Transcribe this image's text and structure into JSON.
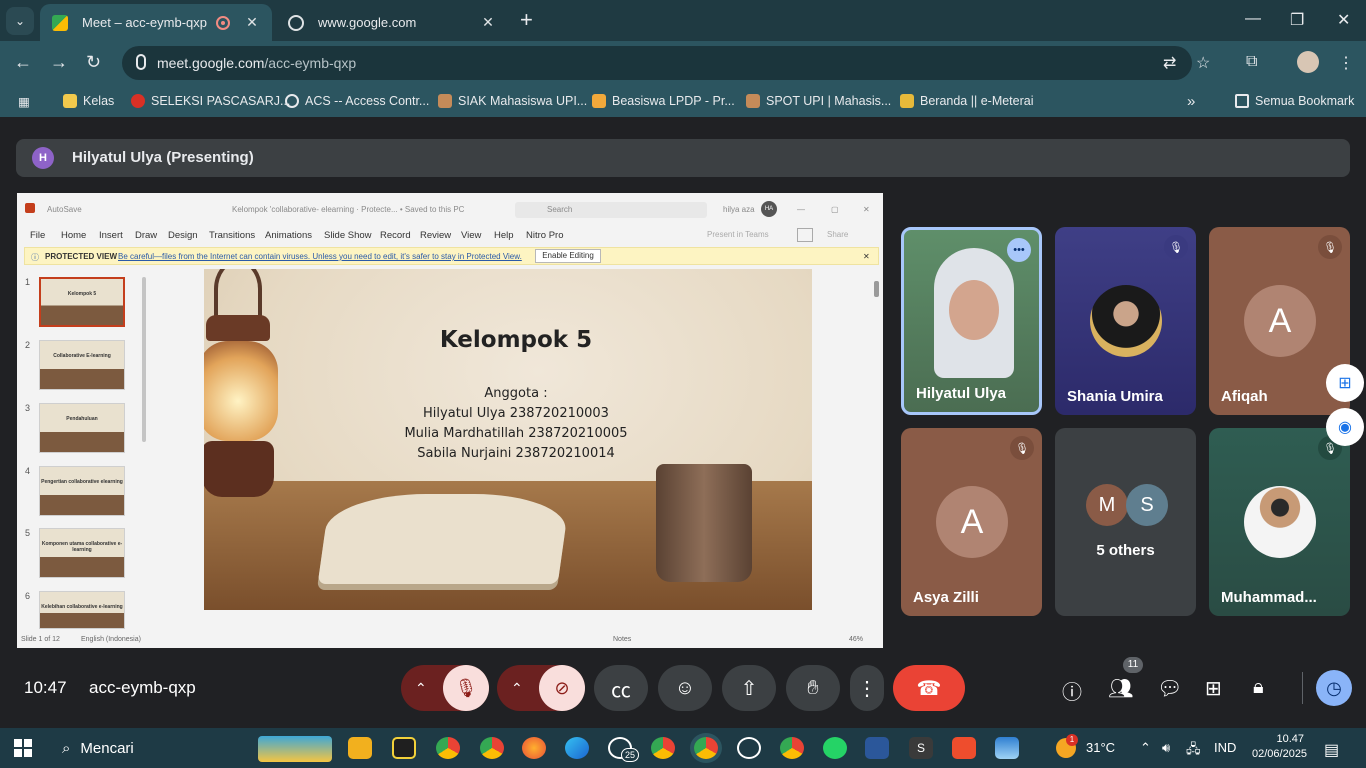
{
  "browser": {
    "tabs": [
      {
        "title": "Meet – acc-eymb-qxp",
        "active": true
      },
      {
        "title": "www.google.com",
        "active": false
      }
    ],
    "url_host": "meet.google.com",
    "url_path": "/acc-eymb-qxp",
    "bookmarks": [
      "Kelas",
      "SELEKSI PASCASARJ...",
      "ACS -- Access Contr...",
      "SIAK Mahasiswa UPI...",
      "Beasiswa LPDP - Pr...",
      "SPOT UPI | Mahasis...",
      "Beranda || e-Meterai"
    ],
    "all_bookmarks": "Semua Bookmark"
  },
  "presenter": {
    "initial": "H",
    "label": "Hilyatul Ulya (Presenting)"
  },
  "ppt": {
    "autosave": "AutoSave",
    "doc_title": "Kelompok 'collaborative- elearning · Protecte... • Saved to this PC",
    "search": "Search",
    "user": "hilya aza",
    "user_initials": "HA",
    "menu": [
      "File",
      "Home",
      "Insert",
      "Draw",
      "Design",
      "Transitions",
      "Animations",
      "Slide Show",
      "Record",
      "Review",
      "View",
      "Help",
      "Nitro Pro"
    ],
    "present_teams": "Present in Teams",
    "share": "Share",
    "protected_label": "PROTECTED VIEW",
    "protected_msg": "Be careful—files from the Internet can contain viruses. Unless you need to edit, it's safer to stay in Protected View.",
    "enable_editing": "Enable Editing",
    "thumbs": [
      {
        "num": "1",
        "title": "Kelompok 5"
      },
      {
        "num": "2",
        "title": "Collaborative E-learning"
      },
      {
        "num": "3",
        "title": "Pendahuluan"
      },
      {
        "num": "4",
        "title": "Pengertian collaborative elearning"
      },
      {
        "num": "5",
        "title": "Komponen utama collaborative e-learning"
      },
      {
        "num": "6",
        "title": "Kelebihan collaborative e-learning"
      }
    ],
    "slide": {
      "title": "Kelompok 5",
      "lines": [
        "Anggota :",
        "Hilyatul Ulya 238720210003",
        "Mulia Mardhatillah 238720210005",
        "Sabila Nurjaini 238720210014"
      ]
    },
    "status_slide": "Slide 1 of 12",
    "status_lang": "English (Indonesia)",
    "status_notes": "Notes",
    "zoom": "46%"
  },
  "participants": [
    {
      "name": "Hilyatul Ulya",
      "type": "video"
    },
    {
      "name": "Shania Umira",
      "type": "photo",
      "muted": true
    },
    {
      "name": "Afiqah",
      "type": "avatar",
      "initial": "A",
      "muted": true
    },
    {
      "name": "Asya Zilli",
      "type": "avatar",
      "initial": "A",
      "muted": true
    },
    {
      "name": "5 others",
      "type": "group",
      "initials": [
        "M",
        "S"
      ]
    },
    {
      "name": "Muhammad...",
      "type": "photo",
      "muted": true
    }
  ],
  "meeting": {
    "time": "10:47",
    "code": "acc-eymb-qxp",
    "people_count": "11"
  },
  "taskbar": {
    "search_placeholder": "Mencari",
    "weather": "31°C",
    "lang": "IND",
    "time": "10.47",
    "date": "02/06/2025",
    "whatsapp_badge": "25",
    "weather_badge": "1"
  },
  "colors": {
    "accent": "#a8c7fa",
    "end_call": "#ea4335",
    "muted_bg": "#f9dedc",
    "tile_brown": "#8a5b47"
  }
}
